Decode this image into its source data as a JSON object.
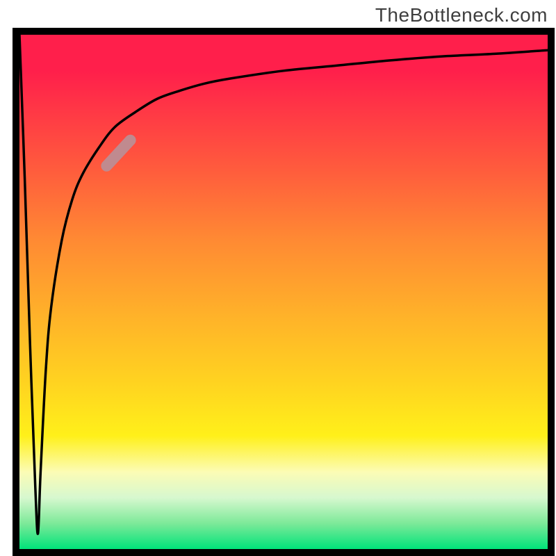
{
  "attribution": "TheBottleneck.com",
  "chart_data": {
    "type": "line",
    "title": "",
    "xlabel": "",
    "ylabel": "",
    "xlim": [
      0,
      100
    ],
    "ylim": [
      0,
      100
    ],
    "description": "Bottleneck-percentage style curve over a vertical rainbow gradient. The x-axis is a hardware-pairing scale (0–100); the y-axis is mismatch percentage (0 green → 100 red). A thin black line starts at 100% at x=0, spikes down to ~3% at x≈3.5, then climbs back toward ~97% by x=100. A short thick pale-rose highlight marks a segment of the rising curve around x≈17–21 (y≈75–80).",
    "series": [
      {
        "name": "bottleneck-curve",
        "x": [
          0,
          1,
          2,
          3,
          3.5,
          4,
          5,
          6,
          8,
          10,
          12,
          15,
          18,
          22,
          26,
          30,
          35,
          40,
          50,
          60,
          70,
          80,
          90,
          100
        ],
        "y": [
          100,
          72,
          40,
          12,
          3,
          15,
          35,
          47,
          60,
          68,
          73,
          78,
          82,
          85,
          87.5,
          89,
          90.5,
          91.5,
          93,
          94,
          95,
          95.8,
          96.3,
          97
        ]
      }
    ],
    "highlight_segment": {
      "name": "highlight",
      "color": "#c08a8f",
      "x": [
        16.5,
        21
      ],
      "y": [
        74.5,
        79.5
      ]
    },
    "gradient_stops": [
      {
        "pct": 0,
        "color": "#ff1f4b"
      },
      {
        "pct": 7,
        "color": "#ff1f4b"
      },
      {
        "pct": 14,
        "color": "#ff3546"
      },
      {
        "pct": 26,
        "color": "#ff5b3d"
      },
      {
        "pct": 40,
        "color": "#ff8a33"
      },
      {
        "pct": 55,
        "color": "#ffb329"
      },
      {
        "pct": 68,
        "color": "#ffd420"
      },
      {
        "pct": 78,
        "color": "#fff01a"
      },
      {
        "pct": 85,
        "color": "#fcfcb5"
      },
      {
        "pct": 90,
        "color": "#d7f8cf"
      },
      {
        "pct": 95,
        "color": "#7de999"
      },
      {
        "pct": 100,
        "color": "#00e37a"
      }
    ]
  }
}
